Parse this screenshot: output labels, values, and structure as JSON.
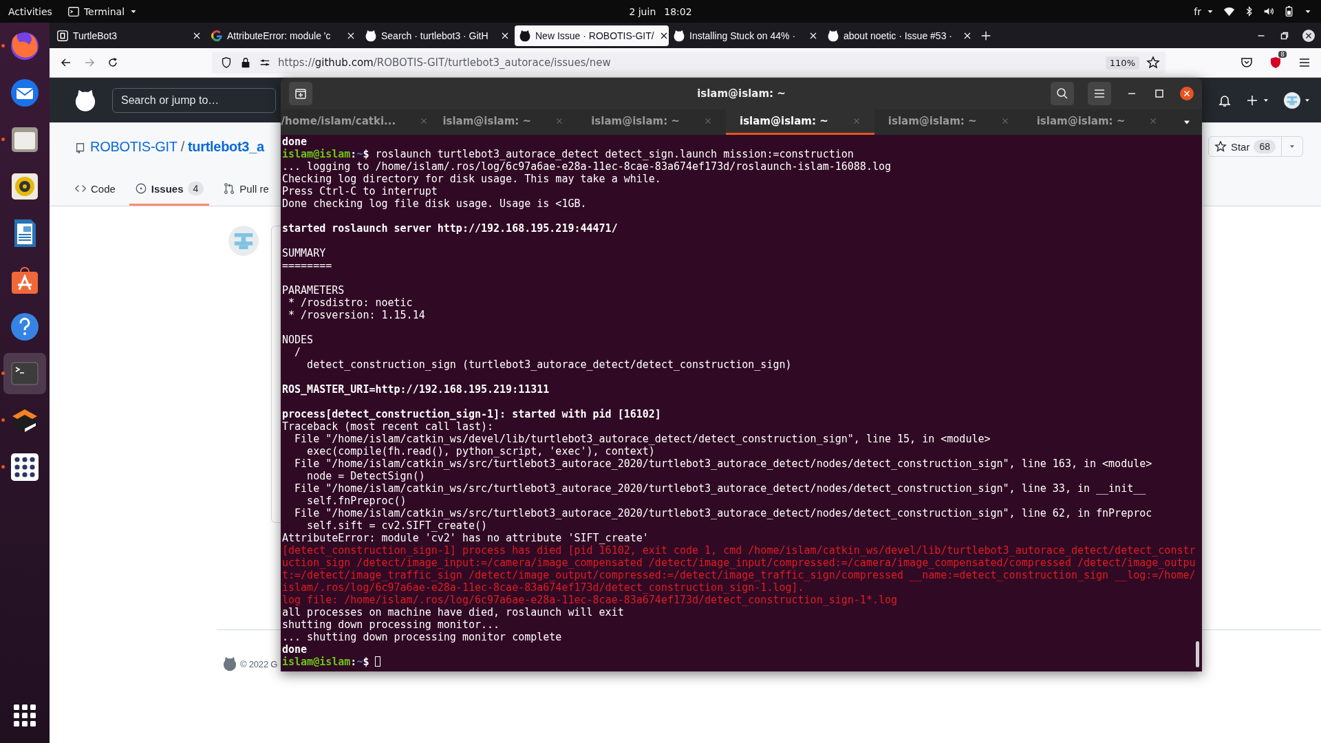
{
  "top_bar": {
    "activities": "Activities",
    "app_menu": "Terminal",
    "date": "2 juin",
    "time": "18:02",
    "keyboard": "fr"
  },
  "dock": [
    {
      "kind": "firefox",
      "running": true,
      "selected": false
    },
    {
      "kind": "thunderbird",
      "running": false,
      "selected": false
    },
    {
      "kind": "files",
      "running": true,
      "selected": false
    },
    {
      "kind": "rhythmbox",
      "running": false,
      "selected": false
    },
    {
      "kind": "writer",
      "running": false,
      "selected": false
    },
    {
      "kind": "software",
      "running": false,
      "selected": false
    },
    {
      "kind": "help",
      "running": false,
      "selected": false
    },
    {
      "kind": "terminal",
      "running": true,
      "selected": true
    },
    {
      "kind": "sublime",
      "running": true,
      "selected": false
    },
    {
      "kind": "grid",
      "running": true,
      "selected": false
    },
    {
      "kind": "apps",
      "running": false,
      "selected": false
    }
  ],
  "browser": {
    "tabs": [
      {
        "title": "TurtleBot3",
        "kind": "robotis",
        "selected": false
      },
      {
        "title": "AttributeError: module 'c",
        "kind": "google",
        "selected": false
      },
      {
        "title": "Search · turtlebot3 · GitH",
        "kind": "github",
        "selected": false
      },
      {
        "title": "New Issue · ROBOTIS-GIT/",
        "kind": "github",
        "selected": true
      },
      {
        "title": "Installing Stuck on 44% ·",
        "kind": "github",
        "selected": false
      },
      {
        "title": "about noetic · Issue #53 ·",
        "kind": "github",
        "selected": false
      }
    ],
    "url": {
      "scheme": "https://",
      "host": "github.com",
      "path": "/ROBOTIS-GIT/turtlebot3_autorace/issues/new"
    },
    "zoom": "110%",
    "extension_badge": "8"
  },
  "github": {
    "search": {
      "placeholder": "Search or jump to…"
    },
    "owner": "ROBOTIS-GIT",
    "separator": "/",
    "repo": "turtlebot3_a",
    "star_label": "Star",
    "star_count": "68",
    "tabs": [
      {
        "kind": "code",
        "label": "Code",
        "selected": false
      },
      {
        "kind": "issues",
        "label": "Issues",
        "count": "4",
        "selected": true
      },
      {
        "kind": "pulls",
        "label": "Pull re",
        "selected": false
      }
    ],
    "footer": "© 2022 G"
  },
  "terminal": {
    "title": "islam@islam: ~",
    "tabs": [
      {
        "label": "/home/islam/catki...",
        "selected": false
      },
      {
        "label": "islam@islam: ~",
        "selected": false
      },
      {
        "label": "islam@islam: ~",
        "selected": false
      },
      {
        "label": "islam@islam: ~",
        "selected": true
      },
      {
        "label": "islam@islam: ~",
        "selected": false
      },
      {
        "label": "islam@islam: ~",
        "selected": false
      }
    ],
    "lines": [
      {
        "kind": "bold",
        "text": "done"
      },
      {
        "kind": "prompt",
        "user": "islam@islam",
        "sep": ":",
        "path": "~",
        "symbol": "$",
        "command": "roslaunch turtlebot3_autorace_detect detect_sign.launch mission:=construction",
        "cursor": false
      },
      {
        "kind": "text",
        "text": "... logging to /home/islam/.ros/log/6c97a6ae-e28a-11ec-8cae-83a674ef173d/roslaunch-islam-16088.log"
      },
      {
        "kind": "text",
        "text": "Checking log directory for disk usage. This may take a while."
      },
      {
        "kind": "text",
        "text": "Press Ctrl-C to interrupt"
      },
      {
        "kind": "text",
        "text": "Done checking log file disk usage. Usage is <1GB."
      },
      {
        "kind": "blank"
      },
      {
        "kind": "bold",
        "text": "started roslaunch server http://192.168.195.219:44471/"
      },
      {
        "kind": "blank"
      },
      {
        "kind": "text",
        "text": "SUMMARY"
      },
      {
        "kind": "text",
        "text": "========"
      },
      {
        "kind": "blank"
      },
      {
        "kind": "text",
        "text": "PARAMETERS"
      },
      {
        "kind": "text",
        "text": " * /rosdistro: noetic"
      },
      {
        "kind": "text",
        "text": " * /rosversion: 1.15.14"
      },
      {
        "kind": "blank"
      },
      {
        "kind": "text",
        "text": "NODES"
      },
      {
        "kind": "text",
        "text": "  /"
      },
      {
        "kind": "text",
        "text": "    detect_construction_sign (turtlebot3_autorace_detect/detect_construction_sign)"
      },
      {
        "kind": "blank"
      },
      {
        "kind": "bold",
        "text": "ROS_MASTER_URI=http://192.168.195.219:11311"
      },
      {
        "kind": "blank"
      },
      {
        "kind": "bold",
        "text": "process[detect_construction_sign-1]: started with pid [16102]"
      },
      {
        "kind": "text",
        "text": "Traceback (most recent call last):"
      },
      {
        "kind": "text",
        "text": "  File \"/home/islam/catkin_ws/devel/lib/turtlebot3_autorace_detect/detect_construction_sign\", line 15, in <module>"
      },
      {
        "kind": "text",
        "text": "    exec(compile(fh.read(), python_script, 'exec'), context)"
      },
      {
        "kind": "text",
        "text": "  File \"/home/islam/catkin_ws/src/turtlebot3_autorace_2020/turtlebot3_autorace_detect/nodes/detect_construction_sign\", line 163, in <module>"
      },
      {
        "kind": "text",
        "text": "    node = DetectSign()"
      },
      {
        "kind": "text",
        "text": "  File \"/home/islam/catkin_ws/src/turtlebot3_autorace_2020/turtlebot3_autorace_detect/nodes/detect_construction_sign\", line 33, in __init__"
      },
      {
        "kind": "text",
        "text": "    self.fnPreproc()"
      },
      {
        "kind": "text",
        "text": "  File \"/home/islam/catkin_ws/src/turtlebot3_autorace_2020/turtlebot3_autorace_detect/nodes/detect_construction_sign\", line 62, in fnPreproc"
      },
      {
        "kind": "text",
        "text": "    self.sift = cv2.SIFT_create()"
      },
      {
        "kind": "text",
        "text": "AttributeError: module 'cv2' has no attribute 'SIFT_create'"
      },
      {
        "kind": "error",
        "text": "[detect_construction_sign-1] process has died [pid 16102, exit code 1, cmd /home/islam/catkin_ws/devel/lib/turtlebot3_autorace_detect/detect_constr"
      },
      {
        "kind": "error",
        "text": "uction_sign /detect/image_input:=/camera/image_compensated /detect/image_input/compressed:=/camera/image_compensated/compressed /detect/image_outpu"
      },
      {
        "kind": "error",
        "text": "t:=/detect/image_traffic_sign /detect/image_output/compressed:=/detect/image_traffic_sign/compressed __name:=detect_construction_sign __log:=/home/"
      },
      {
        "kind": "error",
        "text": "islam/.ros/log/6c97a6ae-e28a-11ec-8cae-83a674ef173d/detect_construction_sign-1.log]."
      },
      {
        "kind": "error",
        "text": "log file: /home/islam/.ros/log/6c97a6ae-e28a-11ec-8cae-83a674ef173d/detect_construction_sign-1*.log"
      },
      {
        "kind": "text",
        "text": "all processes on machine have died, roslaunch will exit"
      },
      {
        "kind": "text",
        "text": "shutting down processing monitor..."
      },
      {
        "kind": "text",
        "text": "... shutting down processing monitor complete"
      },
      {
        "kind": "bold",
        "text": "done"
      },
      {
        "kind": "prompt",
        "user": "islam@islam",
        "sep": ":",
        "path": "~",
        "symbol": "$",
        "cursor": true
      }
    ]
  }
}
